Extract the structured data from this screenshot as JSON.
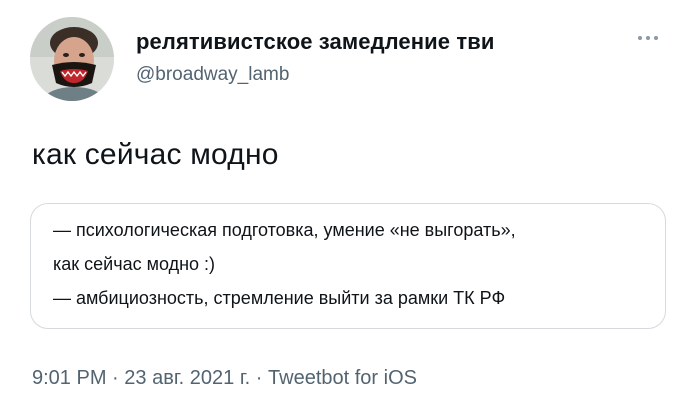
{
  "author": {
    "display_name": "релятивистское замедление тви",
    "handle": "@broadway_lamb"
  },
  "more_icon": "more-dots-icon",
  "tweet": {
    "text": "как сейчас модно"
  },
  "quote": {
    "lines": [
      "— психологическая подготовка, умение «не выгорать»,",
      "как сейчас модно :)",
      "— амбициозность, стремление выйти за рамки ТК РФ"
    ]
  },
  "meta": {
    "time": "9:01 PM",
    "separator": " · ",
    "date": "23 авг. 2021 г.",
    "client": "Tweetbot for iOS"
  },
  "colors": {
    "text": "#0f1419",
    "secondary": "#536471",
    "border": "#d6dade"
  }
}
